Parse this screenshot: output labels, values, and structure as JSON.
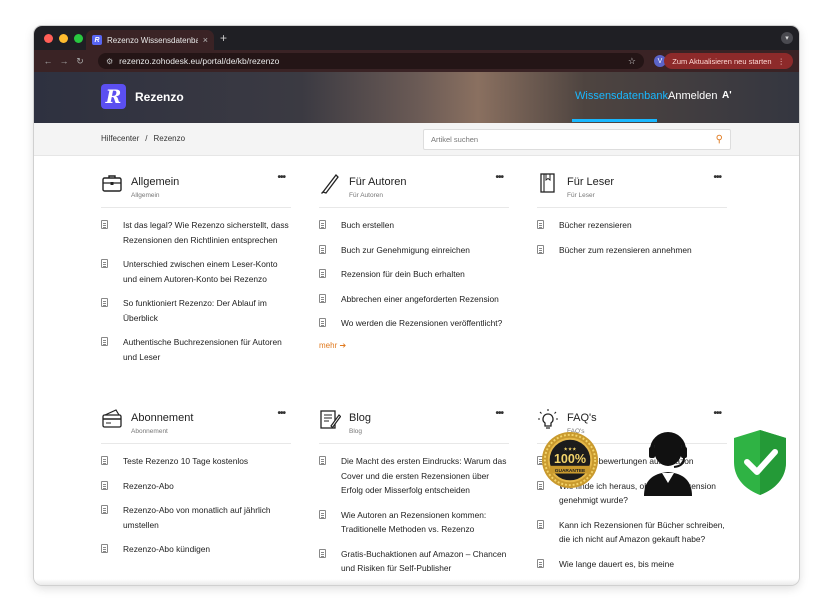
{
  "browser": {
    "tab_title": "Rezenzo Wissensdatenbank",
    "tab_close": "×",
    "new_tab": "+",
    "url": "rezenzo.zohodesk.eu/portal/de/kb/rezenzo",
    "profile_initial": "V",
    "update_button": "Zum Aktualisieren neu starten",
    "update_menu": "⋮"
  },
  "site": {
    "logo_letter": "R",
    "brand": "Rezenzo",
    "nav_kb": "Wissensdatenbank",
    "nav_login": "Anmelden",
    "nav_a11y": "A'"
  },
  "breadcrumb": {
    "home": "Hilfecenter",
    "separator": "/",
    "current": "Rezenzo"
  },
  "search": {
    "placeholder": "Artikel suchen"
  },
  "categories": [
    {
      "title": "Allgemein",
      "subtitle": "Allgemein",
      "more": "•••",
      "articles": [
        "Ist das legal? Wie Rezenzo sicherstellt, dass Rezensionen den Richtlinien entsprechen",
        "Unterschied zwischen einem Leser-Konto und einem Autoren-Konto bei Rezenzo",
        "So funktioniert Rezenzo: Der Ablauf im Überblick",
        "Authentische Buchrezensionen für Autoren und Leser"
      ]
    },
    {
      "title": "Für Autoren",
      "subtitle": "Für Autoren",
      "more": "•••",
      "articles": [
        "Buch erstellen",
        "Buch zur Genehmigung einreichen",
        "Rezension für dein Buch erhalten",
        "Abbrechen einer angeforderten Rezension",
        "Wo werden die Rezensionen veröffentlicht?"
      ],
      "more_link": "mehr ➔"
    },
    {
      "title": "Für Leser",
      "subtitle": "Für Leser",
      "more": "•••",
      "articles": [
        "Bücher rezensieren",
        "Bücher zum rezensieren annehmen"
      ]
    },
    {
      "title": "Abonnement",
      "subtitle": "Abonnement",
      "more": "•••",
      "articles": [
        "Teste Rezenzo 10 Tage kostenlos",
        "Rezenzo-Abo",
        "Rezenzo-Abo von monatlich auf jährlich umstellen",
        "Rezenzo-Abo kündigen"
      ]
    },
    {
      "title": "Blog",
      "subtitle": "Blog",
      "more": "•••",
      "articles": [
        "Die Macht des ersten Eindrucks: Warum das Cover und die ersten Rezensionen über Erfolg oder Misserfolg entscheiden",
        "Wie Autoren an Rezensionen kommen: Traditionelle Methoden vs. Rezenzo",
        "Gratis-Buchaktionen auf Amazon – Chancen und Risiken für Self-Publisher"
      ]
    },
    {
      "title": "FAQ's",
      "subtitle": "FAQ's",
      "more": "•••",
      "articles": [
        "Die Sternebewertungen auf Amazon",
        "Wie finde ich heraus, ob meine Rezension genehmigt wurde?",
        "Kann ich Rezensionen für Bücher schreiben, die ich nicht auf Amazon gekauft habe?",
        "Wie lange dauert es, bis meine"
      ]
    }
  ],
  "badges": {
    "gold_percent": "100%",
    "gold_text": "GUARANTEE",
    "gold_stars": "★★★"
  },
  "colors": {
    "accent_orange": "#e07a1f",
    "nav_active": "#19b8ff",
    "logo_purple": "#5b4ff0",
    "shield_green": "#2fb344"
  }
}
